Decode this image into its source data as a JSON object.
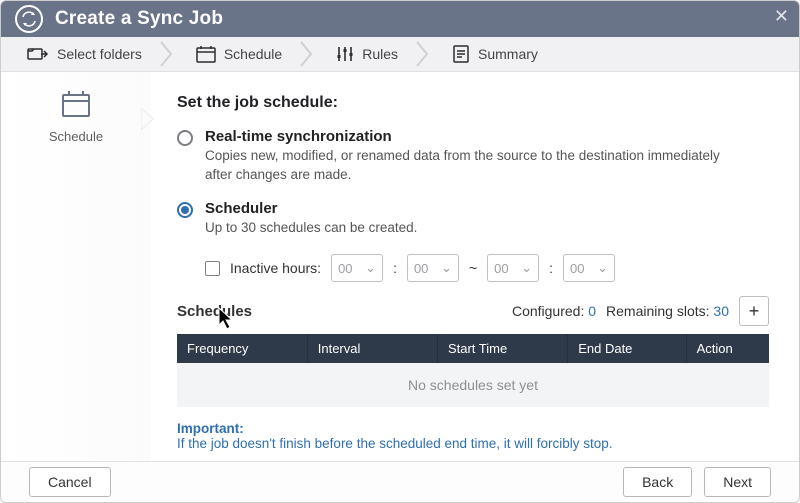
{
  "window": {
    "title": "Create a Sync Job"
  },
  "steps": {
    "s1": "Select folders",
    "s2": "Schedule",
    "s3": "Rules",
    "s4": "Summary"
  },
  "sidebar": {
    "label": "Schedule"
  },
  "content": {
    "heading": "Set the job schedule:",
    "realtime": {
      "title": "Real-time synchronization",
      "desc": "Copies new, modified, or renamed data from the source to the destination immediately after changes are made."
    },
    "scheduler": {
      "title": "Scheduler",
      "desc": "Up to 30 schedules can be created."
    },
    "inactive": {
      "label": "Inactive hours:",
      "h1": "00",
      "m1": "00",
      "h2": "00",
      "m2": "00",
      "colon": ":",
      "tilde": "~"
    },
    "schedules": {
      "label": "Schedules",
      "configured_label": "Configured:",
      "configured_value": "0",
      "remaining_label": "Remaining slots:",
      "remaining_value": "30",
      "cols": {
        "c1": "Frequency",
        "c2": "Interval",
        "c3": "Start Time",
        "c4": "End Date",
        "c5": "Action"
      },
      "empty": "No schedules set yet"
    },
    "important": {
      "label": "Important:",
      "text": "If the job doesn't finish before the scheduled end time, it will forcibly stop."
    }
  },
  "footer": {
    "cancel": "Cancel",
    "back": "Back",
    "next": "Next"
  }
}
